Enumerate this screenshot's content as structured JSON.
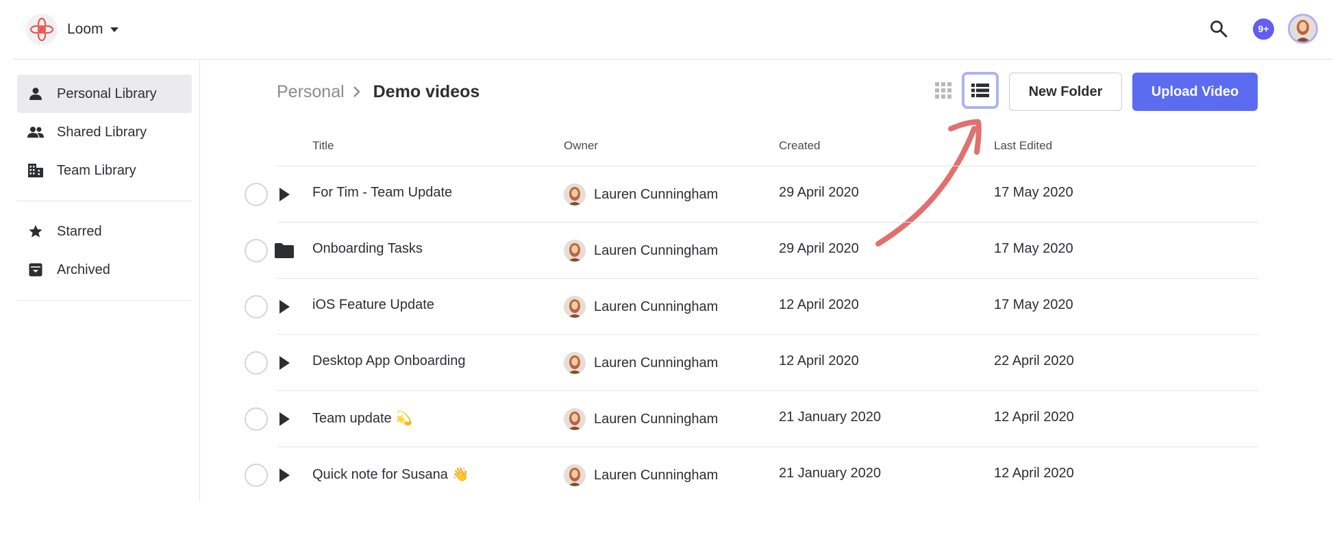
{
  "app": {
    "name": "Loom",
    "notification_count": "9+"
  },
  "sidebar": {
    "primary": [
      {
        "label": "Personal Library",
        "icon": "person-icon",
        "active": true
      },
      {
        "label": "Shared Library",
        "icon": "people-icon",
        "active": false
      },
      {
        "label": "Team Library",
        "icon": "building-icon",
        "active": false
      }
    ],
    "secondary": [
      {
        "label": "Starred",
        "icon": "star-icon"
      },
      {
        "label": "Archived",
        "icon": "archive-icon"
      }
    ]
  },
  "breadcrumb": {
    "parent": "Personal",
    "current": "Demo videos"
  },
  "toolbar": {
    "new_folder_label": "New Folder",
    "upload_label": "Upload Video"
  },
  "table": {
    "columns": [
      "Title",
      "Owner",
      "Created",
      "Last Edited"
    ],
    "rows": [
      {
        "type": "play-icon",
        "title": "For Tim - Team Update",
        "owner": "Lauren Cunningham",
        "created": "29 April 2020",
        "edited": "17 May 2020"
      },
      {
        "type": "folder-icon",
        "title": "Onboarding Tasks",
        "owner": "Lauren Cunningham",
        "created": "29 April 2020",
        "edited": "17 May 2020"
      },
      {
        "type": "play-icon",
        "title": "iOS Feature Update",
        "owner": "Lauren Cunningham",
        "created": "12 April 2020",
        "edited": "17 May 2020"
      },
      {
        "type": "play-icon",
        "title": "Desktop App Onboarding",
        "owner": "Lauren Cunningham",
        "created": "12 April 2020",
        "edited": "22 April 2020"
      },
      {
        "type": "play-icon",
        "title": "Team update 💫",
        "owner": "Lauren Cunningham",
        "created": "21 January 2020",
        "edited": "12 April 2020"
      },
      {
        "type": "play-icon",
        "title": "Quick note for Susana 👋",
        "owner": "Lauren Cunningham",
        "created": "21 January 2020",
        "edited": "12 April 2020"
      }
    ]
  },
  "colors": {
    "accent": "#5b6cf0",
    "badge": "#625df5",
    "annotation_arrow": "#e0716f",
    "active_nav_bg": "#ebebed",
    "focus_ring": "#aeb2f4"
  }
}
